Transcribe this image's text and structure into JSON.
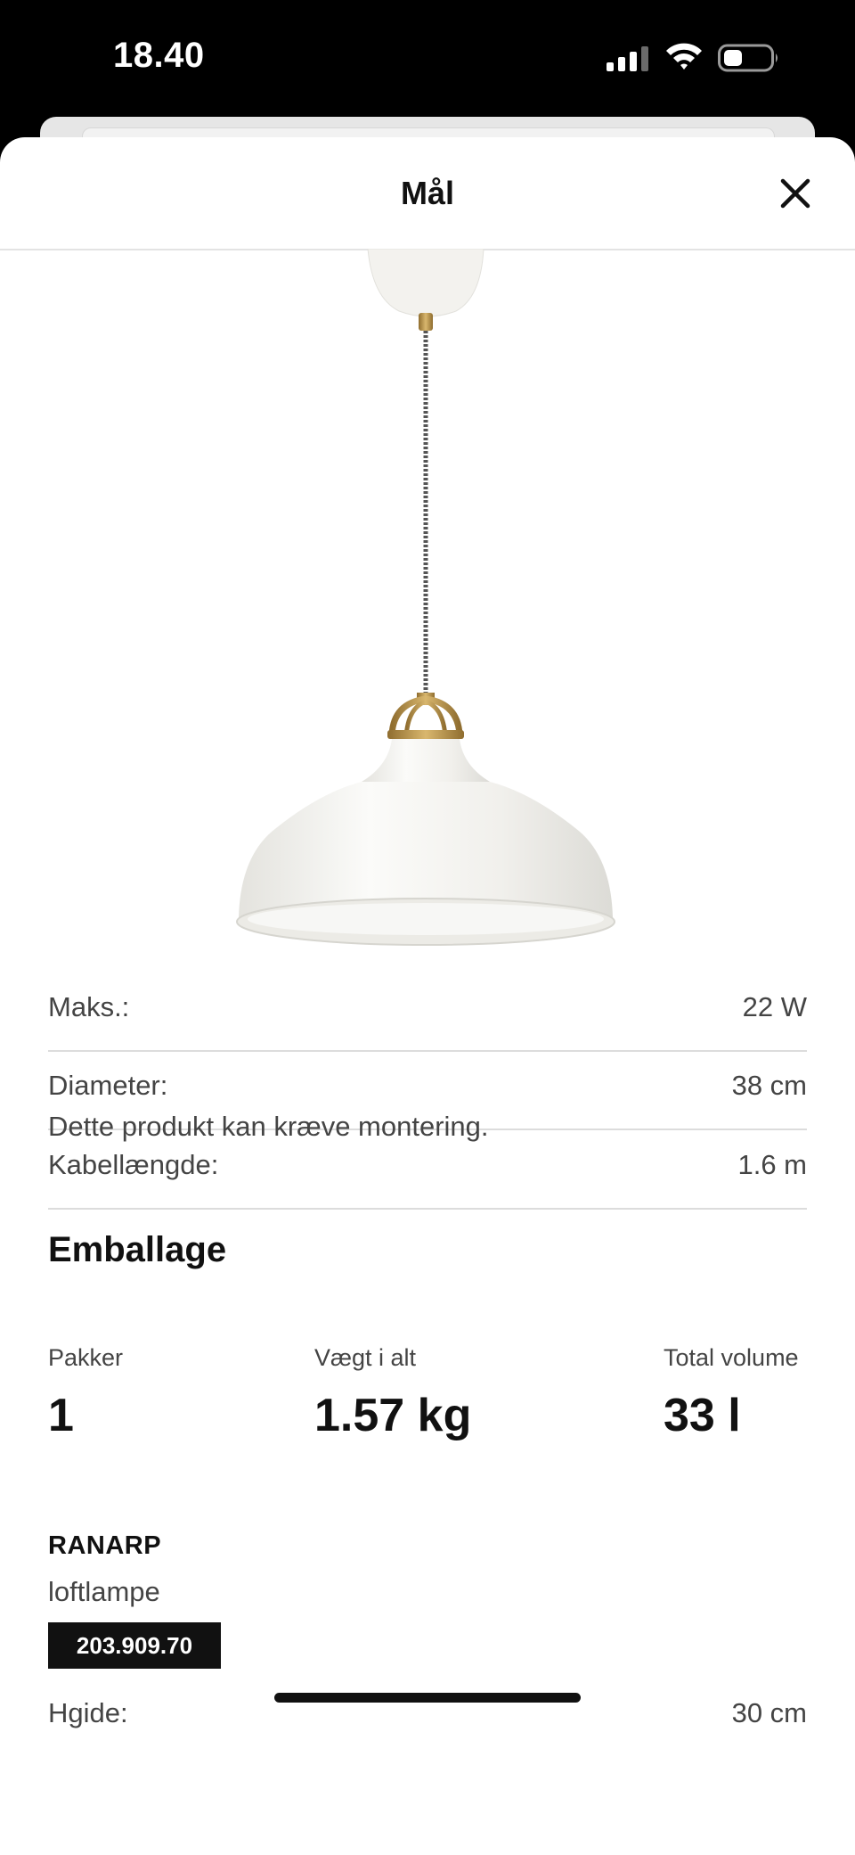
{
  "status_bar": {
    "time": "18.40"
  },
  "modal": {
    "title": "Mål"
  },
  "specs": [
    {
      "label": "Maks.:",
      "value": "22 W"
    },
    {
      "label": "Diameter:",
      "value": "38 cm"
    },
    {
      "label": "Kabellængde:",
      "value": "1.6 m"
    }
  ],
  "note": "Dette produkt kan kræve montering.",
  "packaging": {
    "title": "Emballage",
    "stats": [
      {
        "label": "Pakker",
        "value": "1"
      },
      {
        "label": "Vægt i alt",
        "value": "1.57 kg"
      },
      {
        "label": "Total volume",
        "value": "33 l"
      }
    ]
  },
  "product": {
    "name": "RANARP",
    "type": "loftlampe",
    "article_number": "203.909.70",
    "partial_row": {
      "label": "Hgide:",
      "value": "30 cm"
    }
  },
  "colors": {
    "lamp": "#f4f3ef",
    "brass": "#b8954a",
    "badge": "#111111"
  }
}
